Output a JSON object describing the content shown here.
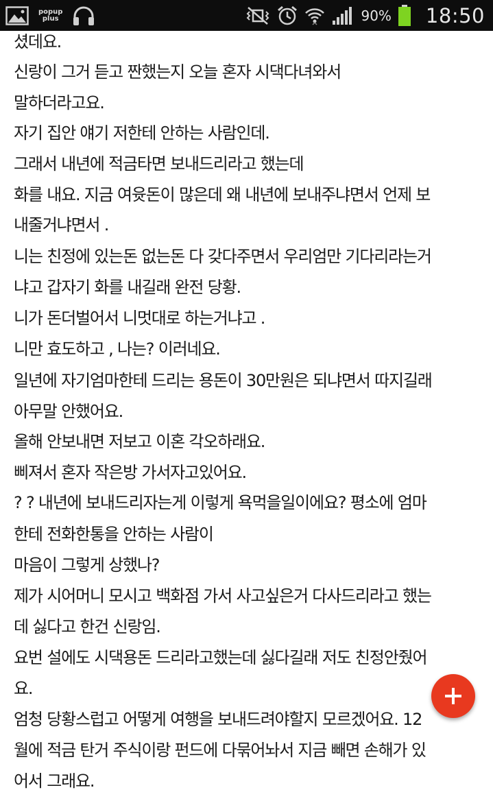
{
  "status_bar": {
    "popup_logo_line1": "popup",
    "popup_logo_line2": "plus",
    "battery_percent": "90%",
    "time": "18:50",
    "icons": [
      "image-icon",
      "popup-plus-logo",
      "headphones-icon",
      "mute-vibrate-icon",
      "alarm-icon",
      "wifi-icon",
      "signal-icon",
      "battery-icon"
    ],
    "battery_color": "#7ed321"
  },
  "article": {
    "lines": [
      "셨데요.",
      "신랑이 그거 듣고 짠했는지 오늘 혼자 시댁다녀와서",
      "말하더라고요.",
      "자기 집안 얘기 저한테 안하는 사람인데.",
      "그래서 내년에 적금타면 보내드리라고 했는데",
      "화를 내요. 지금 여윳돈이 많은데 왜 내년에 보내주냐면서 언제 보",
      "내줄거냐면서 .",
      "니는 친정에 있는돈 없는돈 다 갖다주면서 우리엄만 기다리라는거",
      "냐고 갑자기 화를 내길래 완전 당황.",
      "니가 돈더벌어서 니멋대로 하는거냐고 .",
      "니만 효도하고 , 나는? 이러네요.",
      "일년에 자기엄마한테 드리는 용돈이 30만원은 되냐면서 따지길래",
      "아무말 안했어요.",
      "올해 안보내면 저보고 이혼 각오하래요.",
      "삐져서 혼자 작은방 가서자고있어요.",
      "? ? 내년에 보내드리자는게 이렇게 욕먹을일이에요? 평소에 엄마",
      "한테 전화한통을 안하는 사람이",
      "마음이 그렇게 상했나?",
      "제가 시어머니 모시고 백화점 가서 사고싶은거 다사드리라고 했는",
      "데 싫다고 한건 신랑임.",
      "요번 설에도 시댁용돈 드리라고했는데 싫다길래 저도 친정안줬어",
      "요.",
      "엄청 당황스럽고 어떻게 여행을 보내드려야할지 모르겠어요. 12",
      "월에 적금 탄거 주식이랑 펀드에 다묶어놔서 지금 빼면 손해가 있",
      "어서 그래요."
    ]
  },
  "fab": {
    "icon": "plus-icon",
    "color": "#e8391f"
  }
}
